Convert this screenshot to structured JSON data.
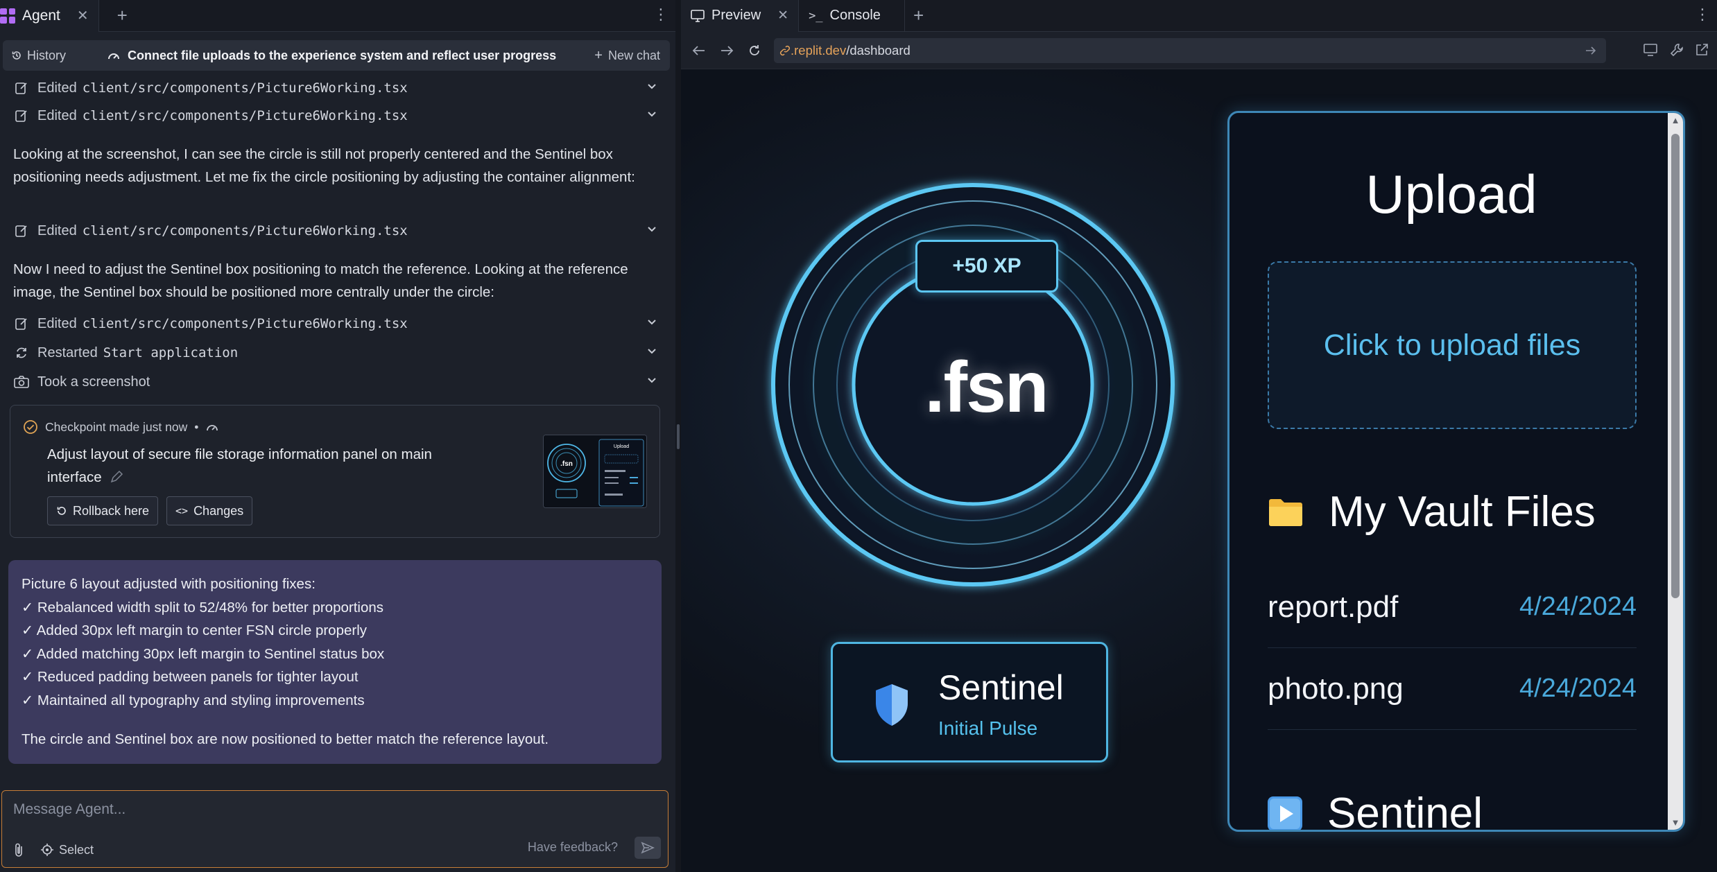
{
  "agent_panel": {
    "tab_label": "Agent",
    "history_label": "History",
    "chat_title": "Connect file uploads to the experience system and reflect user progress",
    "new_chat_label": "New chat",
    "log": [
      {
        "verb": "Edited",
        "target": "client/src/components/Picture6Working.tsx"
      },
      {
        "verb": "Edited",
        "target": "client/src/components/Picture6Working.tsx"
      },
      {
        "verb": "Edited",
        "target": "client/src/components/Picture6Working.tsx"
      },
      {
        "verb": "Edited",
        "target": "client/src/components/Picture6Working.tsx"
      },
      {
        "verb": "Restarted",
        "target": "Start application"
      },
      {
        "verb": "Took a screenshot",
        "target": ""
      }
    ],
    "paragraph_1": "Looking at the screenshot, I can see the circle is still not properly centered and the Sentinel box positioning needs adjustment. Let me fix the circle positioning by adjusting the container alignment:",
    "paragraph_2": "Now I need to adjust the Sentinel box positioning to match the reference. Looking at the reference image, the Sentinel box should be positioned more centrally under the circle:",
    "checkpoint": {
      "status": "Checkpoint made just now",
      "separator": "•",
      "description": "Adjust layout of secure file storage information panel on main interface",
      "rollback_label": "Rollback here",
      "changes_label": "Changes"
    },
    "summary": {
      "heading": "Picture 6 layout adjusted with positioning fixes:",
      "items": [
        "✓ Rebalanced width split to 52/48% for better proportions",
        "✓ Added 30px left margin to center FSN circle properly",
        "✓ Added matching 30px left margin to Sentinel status box",
        "✓ Reduced padding between panels for tighter layout",
        "✓ Maintained all typography and styling improvements"
      ],
      "footer": "The circle and Sentinel box are now positioned to better match the reference layout."
    },
    "message_placeholder": "Message Agent...",
    "select_label": "Select",
    "feedback_label": "Have feedback?"
  },
  "preview_panel": {
    "tabs": [
      "Preview",
      "Console"
    ],
    "url_domain": ".replit.dev",
    "url_path": "/dashboard",
    "app": {
      "xp_badge": "+50 XP",
      "logo_text": ".fsn",
      "sentinel_title": "Sentinel",
      "sentinel_status": "Initial Pulse",
      "upload_title": "Upload",
      "dropzone_label": "Click to upload files",
      "vault_title": "My Vault Files",
      "files": [
        {
          "name": "report.pdf",
          "date": "4/24/2024"
        },
        {
          "name": "photo.png",
          "date": "4/24/2024"
        }
      ],
      "sentinel_section_title": "Sentinel"
    }
  },
  "thumbnail": {
    "upload_label": "Upload",
    "logo_text": ".fsn"
  },
  "colors": {
    "agent_accent": "#b16cf4",
    "summary_bg": "#3c3a5e",
    "message_border": "#c77e38",
    "url_domain": "#e6a35a",
    "neon_blue": "#5cc6f1",
    "file_date": "#4aa9db"
  },
  "icons": {
    "history": "history-icon",
    "new_chat": "plus-icon",
    "edit": "edit-file-icon",
    "restart": "restart-icon",
    "screenshot": "camera-icon",
    "checkpoint": "check-circle-icon",
    "folder": "folder-icon",
    "shield": "shield-icon",
    "play": "play-icon"
  }
}
